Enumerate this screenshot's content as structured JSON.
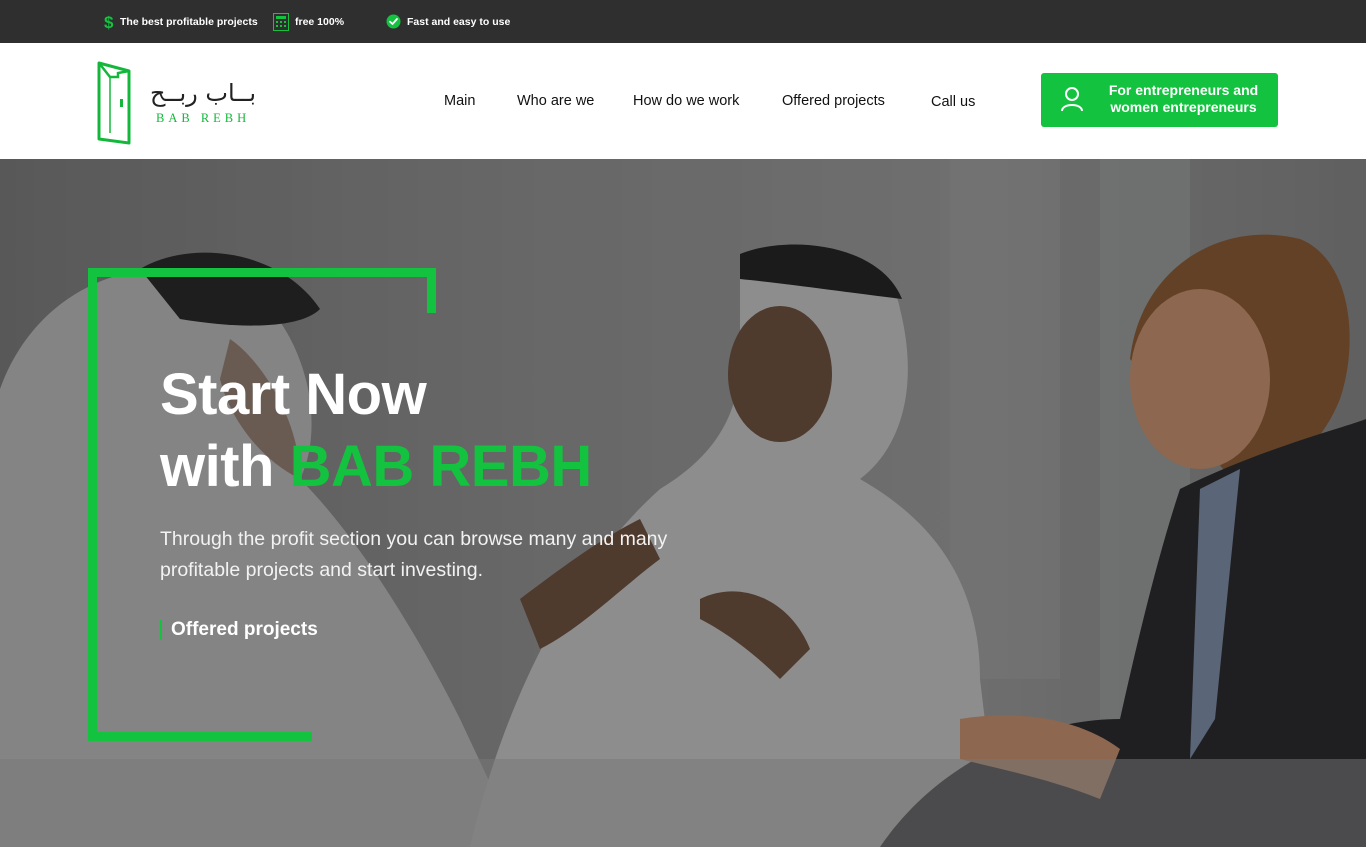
{
  "topbar": {
    "items": [
      {
        "label": "The best profitable projects",
        "icon": "dollar-icon"
      },
      {
        "label": "free 100%",
        "icon": "calculator-icon"
      },
      {
        "label": "Fast and easy to use",
        "icon": "check-circle-icon"
      }
    ]
  },
  "brand": {
    "name_ar": "بــاب ربــح",
    "name_en": "BAB REBH",
    "accent_color": "#13c23e"
  },
  "nav": {
    "items": [
      "Main",
      "Who are we",
      "How do we work",
      "Offered projects",
      "Call us"
    ]
  },
  "cta": {
    "label": "For entrepreneurs and women entrepreneurs",
    "icon": "user-icon"
  },
  "hero": {
    "title_line1": "Start Now",
    "title_line2_prefix": "with",
    "title_line2_accent": "BAB REBH",
    "description": "Through the profit section you can browse many and many profitable projects and start investing.",
    "link_label": "Offered projects"
  }
}
